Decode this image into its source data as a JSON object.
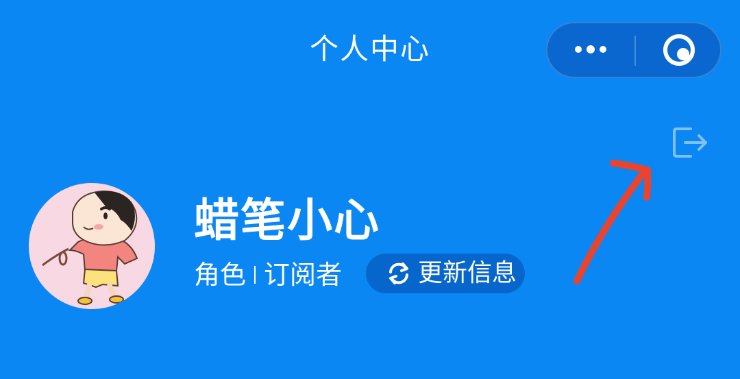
{
  "header": {
    "title": "个人中心",
    "capsule": {
      "more_icon": "more-dots-icon",
      "close_icon": "target-circle-icon"
    }
  },
  "profile": {
    "username": "蜡笔小心",
    "role_label": "角色",
    "role_value": "订阅者",
    "update_button_label": "更新信息",
    "update_icon": "refresh-icon",
    "logout_icon": "logout-icon",
    "avatar": "cartoon-avatar"
  },
  "colors": {
    "background": "#0b87f4",
    "capsule": "#0a67cf",
    "update_button": "#0766cc",
    "annotation_arrow": "#e8442e"
  }
}
